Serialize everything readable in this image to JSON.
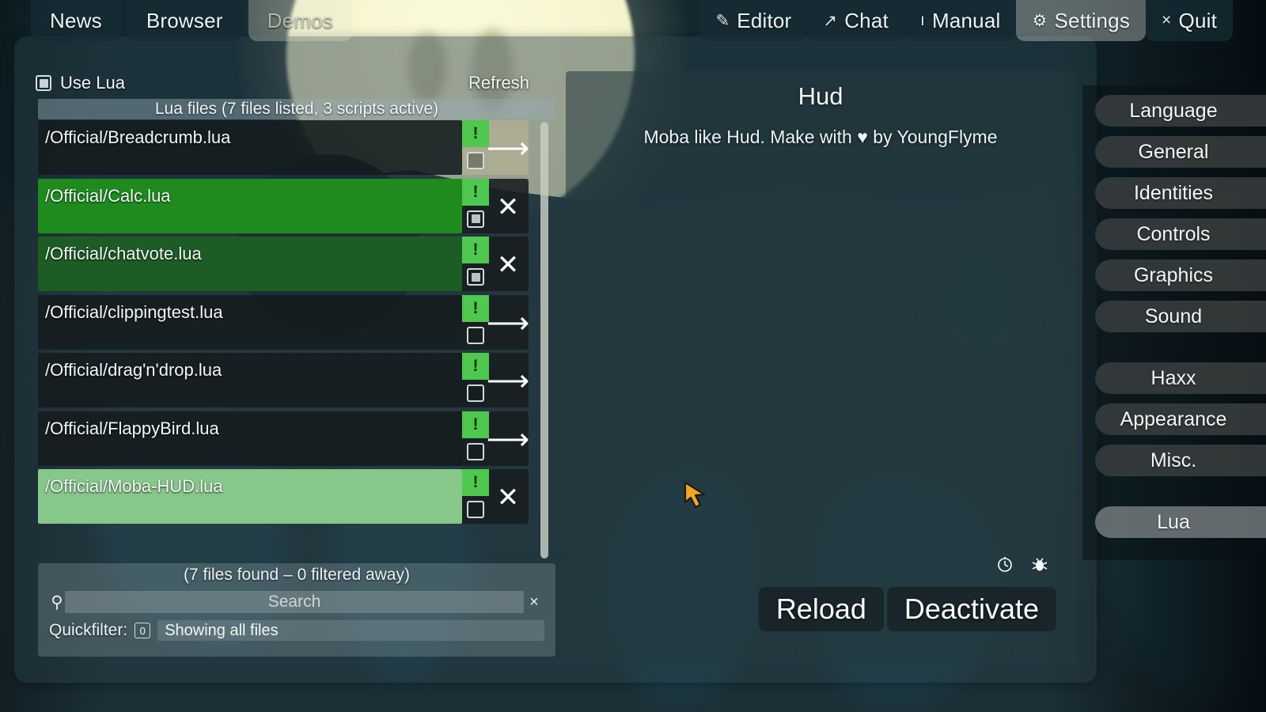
{
  "tabs_left": [
    {
      "label": "News",
      "state": "normal"
    },
    {
      "label": "Browser",
      "state": "normal"
    },
    {
      "label": "Demos",
      "state": "ghost"
    }
  ],
  "tabs_right": [
    {
      "icon": "✎",
      "icon_name": "pencil-icon",
      "label": "Editor",
      "state": "normal"
    },
    {
      "icon": "↗",
      "icon_name": "arrow-up-right-icon",
      "label": "Chat",
      "state": "normal"
    },
    {
      "icon": "ı",
      "icon_name": "info-icon",
      "label": "Manual",
      "state": "normal"
    },
    {
      "icon": "⚙",
      "icon_name": "gear-icon",
      "label": "Settings",
      "state": "active"
    },
    {
      "icon": "×",
      "icon_name": "close-icon",
      "label": "Quit",
      "state": "normal"
    }
  ],
  "lua_panel": {
    "use_lua_label": "Use Lua",
    "use_lua_checked": true,
    "refresh_label": "Refresh",
    "list_header": "Lua files (7 files listed, 3 scripts active)",
    "files": [
      {
        "path": "/Official/Breadcrumb.lua",
        "active": false,
        "highlight": "none",
        "checked": false,
        "action": "arrow",
        "action_glyph": "⟶",
        "bang": "!"
      },
      {
        "path": "/Official/Calc.lua",
        "active": true,
        "highlight": "bright",
        "checked": true,
        "action": "close",
        "action_glyph": "✕",
        "bang": "!"
      },
      {
        "path": "/Official/chatvote.lua",
        "active": true,
        "highlight": "dark",
        "checked": true,
        "action": "close",
        "action_glyph": "✕",
        "bang": "!"
      },
      {
        "path": "/Official/clippingtest.lua",
        "active": false,
        "highlight": "none",
        "checked": false,
        "action": "arrow",
        "action_glyph": "⟶",
        "bang": "!"
      },
      {
        "path": "/Official/drag'n'drop.lua",
        "active": false,
        "highlight": "none",
        "checked": false,
        "action": "arrow",
        "action_glyph": "⟶",
        "bang": "!"
      },
      {
        "path": "/Official/FlappyBird.lua",
        "active": false,
        "highlight": "none",
        "checked": false,
        "action": "arrow",
        "action_glyph": "⟶",
        "bang": "!"
      },
      {
        "path": "/Official/Moba-HUD.lua",
        "active": true,
        "highlight": "light",
        "checked": false,
        "action": "close",
        "action_glyph": "✕",
        "bang": "!"
      }
    ],
    "found_line": "(7 files found – 0 filtered away)",
    "search_placeholder": "Search",
    "search_value": "",
    "search_clear": "×",
    "search_icon": "⚲",
    "quickfilter_label": "Quickfilter:",
    "quickfilter_badge": "0",
    "quickfilter_value": "Showing all files"
  },
  "script_panel": {
    "title": "Hud",
    "description": "Moba like Hud. Make with ♥ by YoungFlyme",
    "icons": [
      {
        "name": "stopwatch-icon",
        "glyph": "◴"
      },
      {
        "name": "bug-icon",
        "glyph": "☀"
      }
    ],
    "buttons": [
      {
        "label": "Reload"
      },
      {
        "label": "Deactivate"
      }
    ]
  },
  "sidebar": {
    "items": [
      {
        "label": "Language",
        "active": false,
        "spacer": false
      },
      {
        "label": "General",
        "active": false,
        "spacer": false
      },
      {
        "label": "Identities",
        "active": false,
        "spacer": false
      },
      {
        "label": "Controls",
        "active": false,
        "spacer": false
      },
      {
        "label": "Graphics",
        "active": false,
        "spacer": false
      },
      {
        "label": "Sound",
        "active": false,
        "spacer": false
      },
      {
        "label": "",
        "active": false,
        "spacer": true
      },
      {
        "label": "Haxx",
        "active": false,
        "spacer": false
      },
      {
        "label": "Appearance",
        "active": false,
        "spacer": false
      },
      {
        "label": "Misc.",
        "active": false,
        "spacer": false
      },
      {
        "label": "",
        "active": false,
        "spacer": true
      },
      {
        "label": "Lua",
        "active": true,
        "spacer": false
      }
    ]
  },
  "colors": {
    "accent_green": "#4ec84e",
    "row_active_bright": "#1f8b1f",
    "row_active_dark": "#1d5c24",
    "row_active_light": "#87c78a",
    "panel_bg": "#2a363c",
    "cursor": "#f5a623"
  }
}
